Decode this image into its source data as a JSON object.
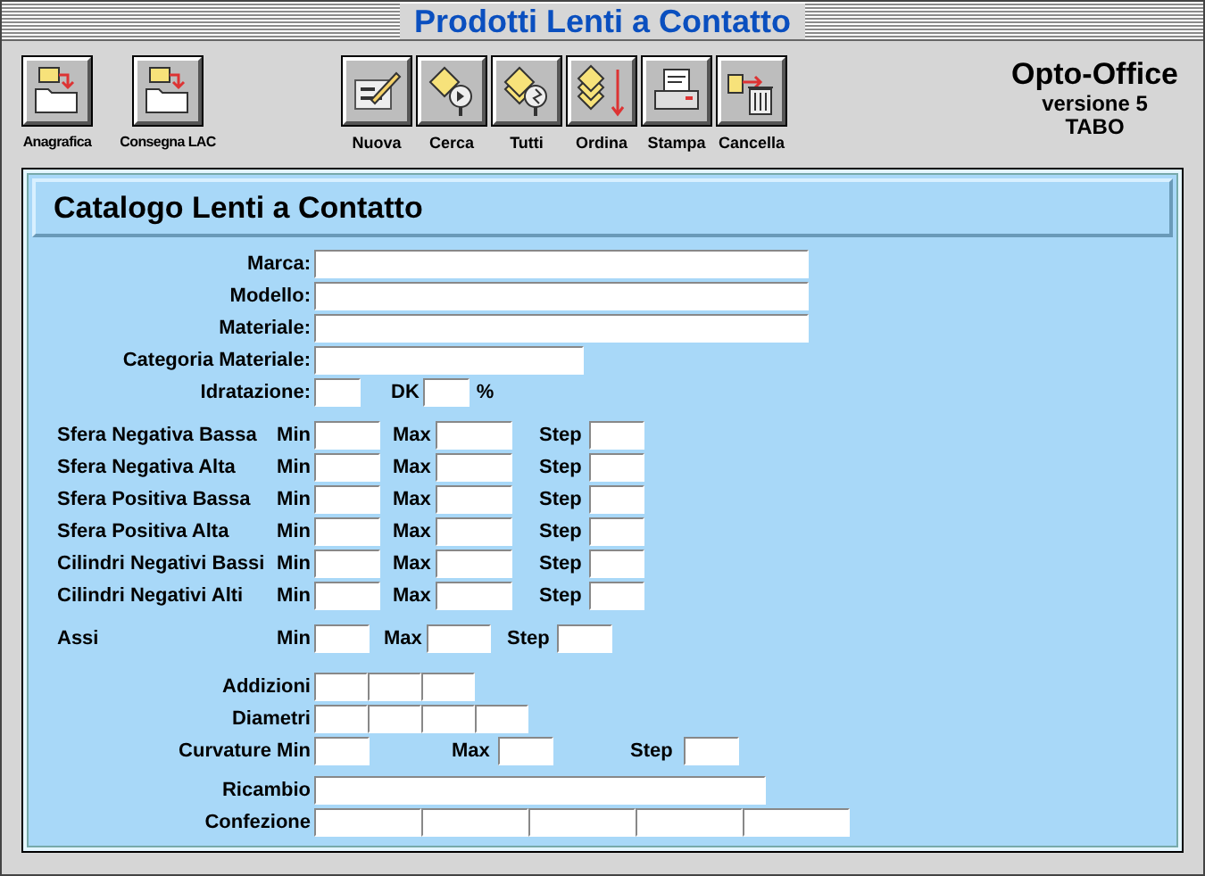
{
  "window": {
    "title": "Prodotti Lenti a Contatto"
  },
  "toolbar_left": [
    {
      "label": "Anagrafica"
    },
    {
      "label": "Consegna LAC"
    }
  ],
  "toolbar": [
    {
      "label": "Nuova"
    },
    {
      "label": "Cerca"
    },
    {
      "label": "Tutti"
    },
    {
      "label": "Ordina"
    },
    {
      "label": "Stampa"
    },
    {
      "label": "Cancella"
    }
  ],
  "app": {
    "name": "Opto-Office",
    "version": "versione 5",
    "user": "TABO"
  },
  "form": {
    "title": "Catalogo Lenti a Contatto",
    "rows": [
      {
        "kind": "long",
        "label": "Marca:"
      },
      {
        "kind": "long",
        "label": "Modello:"
      },
      {
        "kind": "long",
        "label": "Materiale:"
      },
      {
        "kind": "medium",
        "label": "Categoria Materiale:"
      },
      {
        "kind": "pair",
        "label": "Idratazione:",
        "label_2": "DK",
        "unit": "%"
      },
      {
        "kind": "range",
        "label": "Sfera Negativa Bassa",
        "min": "Min",
        "max": "Max",
        "step": "Step"
      },
      {
        "kind": "range",
        "label": "Sfera Negativa Alta",
        "min": "Min",
        "max": "Max",
        "step": "Step"
      },
      {
        "kind": "range",
        "label": "Sfera Positiva Bassa",
        "min": "Min",
        "max": "Max",
        "step": "Step"
      },
      {
        "kind": "range",
        "label": "Sfera Positiva Alta",
        "min": "Min",
        "max": "Max",
        "step": "Step"
      },
      {
        "kind": "range",
        "label": "Cilindri Negativi Bassi",
        "min": "Min",
        "max": "Max",
        "step": "Step"
      },
      {
        "kind": "range",
        "label": "Cilindri Negativi Alti",
        "min": "Min",
        "max": "Max",
        "step": "Step"
      },
      {
        "kind": "assi",
        "label": "Assi",
        "min": "Min",
        "max": "Max",
        "step": "Step"
      },
      {
        "kind": "triple",
        "label": "Addizioni"
      },
      {
        "kind": "quadruple",
        "label": "Diametri"
      },
      {
        "kind": "curvature",
        "label": "Curvature Min",
        "max": "Max",
        "step": "Step"
      },
      {
        "kind": "longer",
        "label": "Ricambio"
      },
      {
        "kind": "quintuple",
        "label": "Confezione"
      }
    ]
  }
}
